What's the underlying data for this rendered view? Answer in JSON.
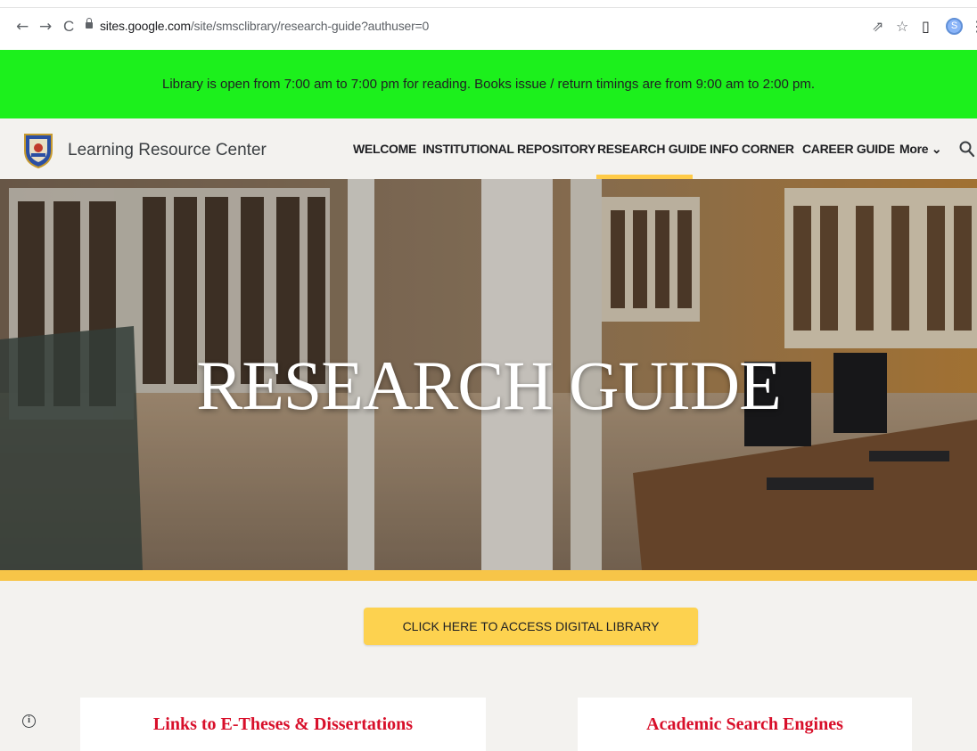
{
  "browser": {
    "url_host": "sites.google.com",
    "url_path": "/site/smsclibrary/research-guide?authuser=0",
    "back_icon": "←",
    "forward_icon": "→",
    "reload_icon": "C",
    "share_icon": "⇗",
    "star_icon": "☆",
    "sidepanel_icon": "▯",
    "avatar_letter": "S",
    "menu_icon": "⋮"
  },
  "announcement": {
    "text": "Library is open from 7:00 am to 7:00 pm for reading. Books issue / return timings are from 9:00 am to 2:00 pm.",
    "bg_color": "#1cf01c"
  },
  "site": {
    "title": "Learning Resource Center",
    "nav": [
      {
        "label": "WELCOME"
      },
      {
        "label": "INSTITUTIONAL REPOSITORY"
      },
      {
        "label": "RESEARCH GUIDE",
        "active": true
      },
      {
        "label": "INFO CORNER"
      },
      {
        "label": "CAREER GUIDE"
      },
      {
        "label": "More ⌄"
      }
    ],
    "accent_color": "#ffcb47"
  },
  "hero": {
    "title": "RESEARCH GUIDE"
  },
  "cta": {
    "label": "CLICK HERE TO ACCESS DIGITAL LIBRARY"
  },
  "cards": [
    {
      "title": "Links to E-Theses & Dissertations"
    },
    {
      "title": "Academic Search Engines"
    }
  ],
  "footer": {
    "info_icon": "i"
  }
}
